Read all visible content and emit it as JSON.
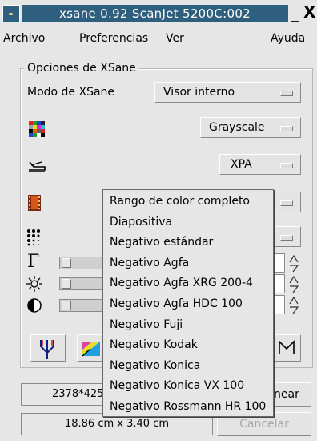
{
  "window": {
    "title": "xsane 0.92 ScanJet 5200C:002",
    "minimize_glyph": "_",
    "close_glyph": "X"
  },
  "menubar": {
    "items": [
      "Archivo",
      "Preferencias",
      "Ver",
      "Ayuda"
    ]
  },
  "options_group": {
    "title": "Opciones de XSane",
    "mode_label": "Modo de XSane",
    "mode_value": "Visor interno",
    "color_mode_value": "Grayscale",
    "source_value": "XPA"
  },
  "icons": {
    "color_mode": "color-grid-icon",
    "source": "scanner-icon",
    "film": "film-strip-icon",
    "resolution": "dots-pattern-icon",
    "gamma": "gamma-icon",
    "brightness": "sun-icon",
    "contrast": "contrast-icon"
  },
  "film_type_menu": {
    "options": [
      "Rango de color completo",
      "Diapositiva",
      "Negativo estándar",
      "Negativo Agfa",
      "Negativo Agfa XRG 200-4",
      "Negativo Agfa HDC 100",
      "Negativo Fuji",
      "Negativo Kodak",
      "Negativo Konica",
      "Negativo Konica VX 100",
      "Negativo Rossmann HR 100"
    ]
  },
  "bottom": {
    "pixel_size": "2378*425",
    "physical_size": "18.86 cm x 3.40 cm",
    "scan_button_partial": "near",
    "cancel_button": "Cancelar"
  },
  "colors": {
    "titlebar": "#2f5f7f",
    "background": "#e6e6e6"
  }
}
